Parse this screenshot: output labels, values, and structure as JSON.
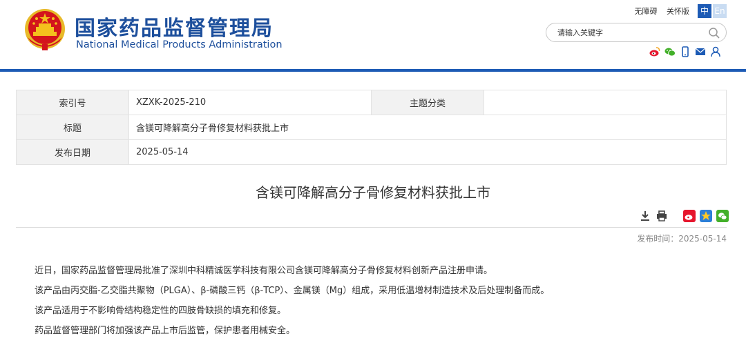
{
  "header": {
    "title_cn": "国家药品监督管理局",
    "title_en": "National Medical Products Administration",
    "links": {
      "accessible": "无障碍",
      "care": "关怀版"
    },
    "lang": {
      "zh": "中",
      "en": "En"
    },
    "search": {
      "placeholder": "请输入关键字"
    },
    "social_icons": [
      "weibo-icon",
      "wechat-icon",
      "mobile-icon",
      "mail-icon",
      "user-icon"
    ]
  },
  "info": {
    "rows": [
      {
        "key": "索引号",
        "value": "XZXK-2025-210",
        "key2": "主题分类",
        "value2": ""
      },
      {
        "key": "标题",
        "value": "含镁可降解高分子骨修复材料获批上市"
      },
      {
        "key": "发布日期",
        "value": "2025-05-14"
      }
    ]
  },
  "article": {
    "title": "含镁可降解高分子骨修复材料获批上市",
    "publish_label": "发布时间：2025-05-14",
    "paragraphs": [
      "近日，国家药品监督管理局批准了深圳中科精诚医学科技有限公司含镁可降解高分子骨修复材料创新产品注册申请。",
      "该产品由丙交脂-乙交脂共聚物（PLGA）、β-磷酸三钙（β-TCP）、金属镁（Mg）组成，采用低温增材制造技术及后处理制备而成。",
      "该产品适用于不影响骨结构稳定性的四肢骨缺损的填充和修复。",
      "药品监督管理部门将加强该产品上市后监管，保护患者用械安全。"
    ]
  },
  "colors": {
    "brand_blue": "#1d4f9c",
    "bar_blue": "#1d5bb5",
    "emblem_red": "#d3141c",
    "emblem_gold": "#f4c11d"
  }
}
